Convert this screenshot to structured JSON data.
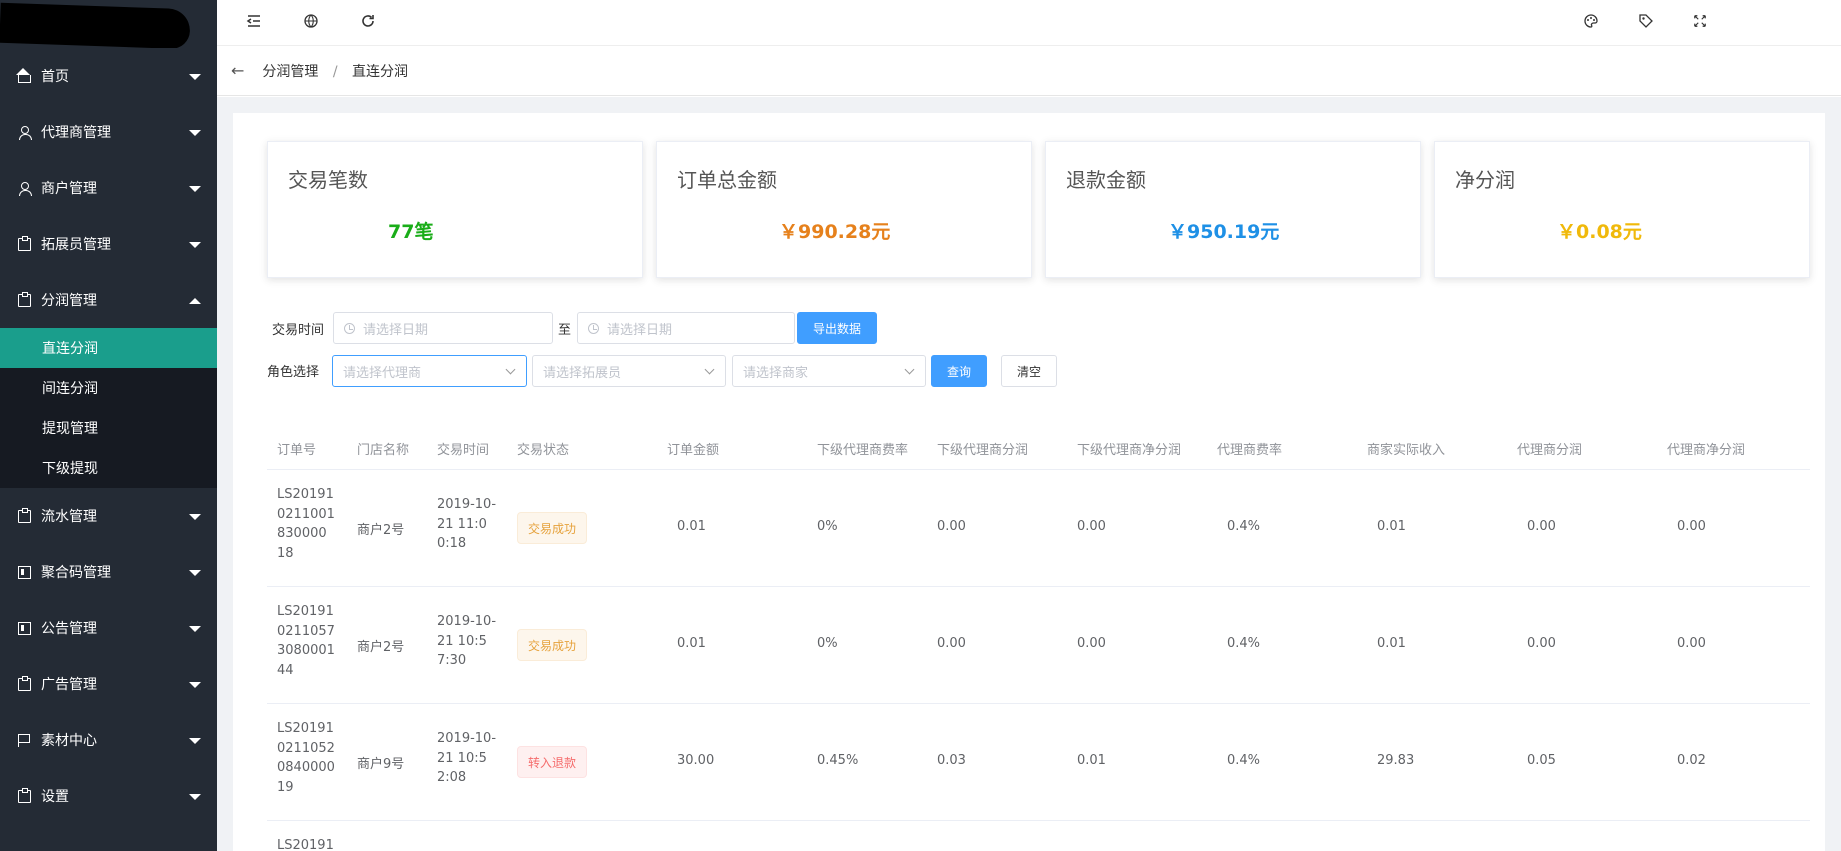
{
  "sidebar": {
    "menu": [
      {
        "label": "首页",
        "icon": "home-icon"
      },
      {
        "label": "代理商管理",
        "icon": "user-icon"
      },
      {
        "label": "商户管理",
        "icon": "user-icon"
      },
      {
        "label": "拓展员管理",
        "icon": "clipboard-icon"
      },
      {
        "label": "分润管理",
        "icon": "clipboard-icon"
      }
    ],
    "submenu": [
      {
        "label": "直连分润",
        "active": true
      },
      {
        "label": "间连分润"
      },
      {
        "label": "提现管理"
      },
      {
        "label": "下级提现"
      }
    ],
    "menu2": [
      {
        "label": "流水管理",
        "icon": "clipboard-icon"
      },
      {
        "label": "聚合码管理",
        "icon": "qrcode-icon"
      },
      {
        "label": "公告管理",
        "icon": "qrcode-icon"
      },
      {
        "label": "广告管理",
        "icon": "clipboard-icon"
      },
      {
        "label": "素材中心",
        "icon": "flag-icon"
      },
      {
        "label": "设置",
        "icon": "clipboard-icon"
      }
    ]
  },
  "breadcrumb": {
    "parent": "分润管理",
    "separator": "/",
    "current": "直连分润"
  },
  "stats": [
    {
      "title": "交易笔数",
      "value": "77笔",
      "color": "#1aad19"
    },
    {
      "title": "订单总金额",
      "value": "￥990.28元",
      "color": "#e6811c"
    },
    {
      "title": "退款金额",
      "value": "￥950.19元",
      "color": "#1e90e6"
    },
    {
      "title": "净分润",
      "value": "￥0.08元",
      "color": "#f0b90b"
    }
  ],
  "filters": {
    "time_label": "交易时间",
    "date_placeholder": "请选择日期",
    "to_label": "至",
    "export_button": "导出数据",
    "role_label": "角色选择",
    "agent_placeholder": "请选择代理商",
    "promoter_placeholder": "请选择拓展员",
    "merchant_placeholder": "请选择商家",
    "query_button": "查询",
    "clear_button": "清空"
  },
  "table": {
    "headers": [
      "订单号",
      "门店名称",
      "交易时间",
      "交易状态",
      "订单金额",
      "下级代理商费率",
      "下级代理商分润",
      "下级代理商净分润",
      "代理商费率",
      "商家实际收入",
      "代理商分润",
      "代理商净分润"
    ],
    "rows": [
      {
        "order_no": "LS201910211001830000 18",
        "store": "商户2号",
        "time": "2019-10-21 11:00:18",
        "status": "交易成功",
        "amount": "0.01",
        "sub_rate": "0%",
        "sub_profit": "0.00",
        "sub_net": "0.00",
        "agent_rate": "0.4%",
        "merchant_income": "0.01",
        "agent_profit": "0.00",
        "agent_net": "0.00"
      },
      {
        "order_no": "LS201910211057308000144",
        "store": "商户2号",
        "time": "2019-10-21 10:57:30",
        "status": "交易成功",
        "amount": "0.01",
        "sub_rate": "0%",
        "sub_profit": "0.00",
        "sub_net": "0.00",
        "agent_rate": "0.4%",
        "merchant_income": "0.01",
        "agent_profit": "0.00",
        "agent_net": "0.00"
      },
      {
        "order_no": "LS201910211052084000019",
        "store": "商户9号",
        "time": "2019-10-21 10:52:08",
        "status": "转入退款",
        "amount": "30.00",
        "sub_rate": "0.45%",
        "sub_profit": "0.03",
        "sub_net": "0.01",
        "agent_rate": "0.4%",
        "merchant_income": "29.83",
        "agent_profit": "0.05",
        "agent_net": "0.02"
      },
      {
        "order_no": "LS20191"
      }
    ]
  }
}
